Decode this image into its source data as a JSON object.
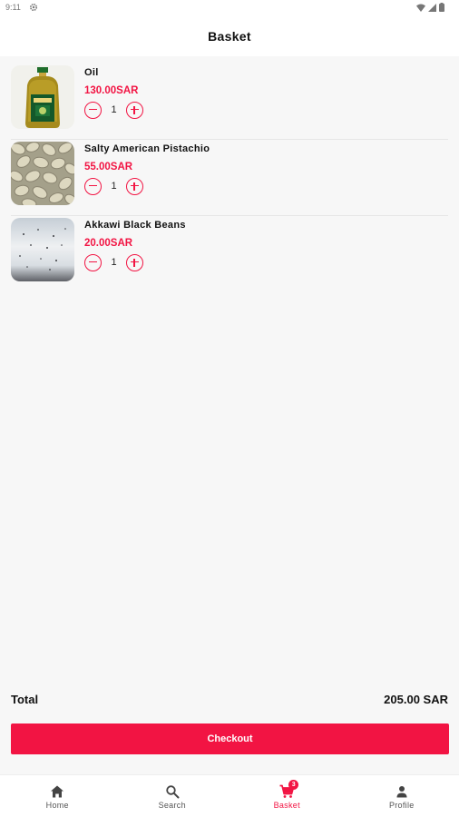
{
  "status_bar": {
    "time": "9:11"
  },
  "header": {
    "title": "Basket"
  },
  "basket": {
    "items": [
      {
        "name": "Oil",
        "price": "130.00SAR",
        "quantity": "1",
        "image_icon": "olive-oil-bottle-image"
      },
      {
        "name": "Salty American Pistachio",
        "price": "55.00SAR",
        "quantity": "1",
        "image_icon": "pistachio-nuts-image"
      },
      {
        "name": "Akkawi Black Beans",
        "price": "20.00SAR",
        "quantity": "1",
        "image_icon": "akkawi-cheese-image"
      }
    ]
  },
  "summary": {
    "total_label": "Total",
    "total_value": "205.00 SAR"
  },
  "checkout": {
    "label": "Checkout"
  },
  "nav": {
    "items": [
      {
        "label": "Home",
        "icon": "home-icon"
      },
      {
        "label": "Search",
        "icon": "search-icon"
      },
      {
        "label": "Basket",
        "icon": "cart-icon",
        "badge": "3",
        "active": true
      },
      {
        "label": "Profile",
        "icon": "person-icon"
      }
    ]
  },
  "colors": {
    "accent": "#f21443",
    "background": "#f7f7f7",
    "surface": "#ffffff"
  }
}
